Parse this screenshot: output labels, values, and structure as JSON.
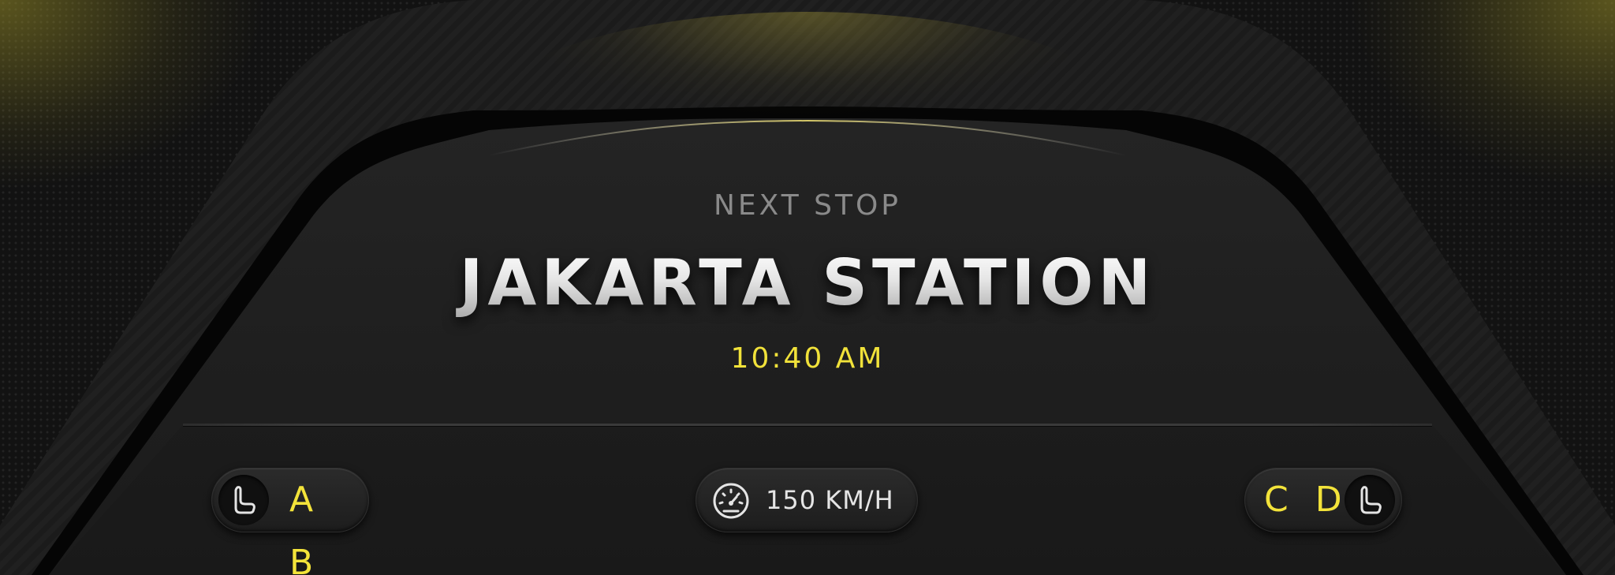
{
  "next_stop": {
    "label": "NEXT STOP",
    "station": "JAKARTA STATION",
    "time": "10:40 AM"
  },
  "left_seats": {
    "icon": "seat-icon",
    "label": "A B"
  },
  "speed": {
    "icon": "speedometer-icon",
    "label": "150 KM/H"
  },
  "right_seats": {
    "icon": "seat-icon",
    "label": "C D"
  },
  "colors": {
    "accent": "#f1e23a",
    "text_primary": "#e8e8e8",
    "text_muted": "#8a8a8a",
    "background": "#1c1c1c"
  }
}
